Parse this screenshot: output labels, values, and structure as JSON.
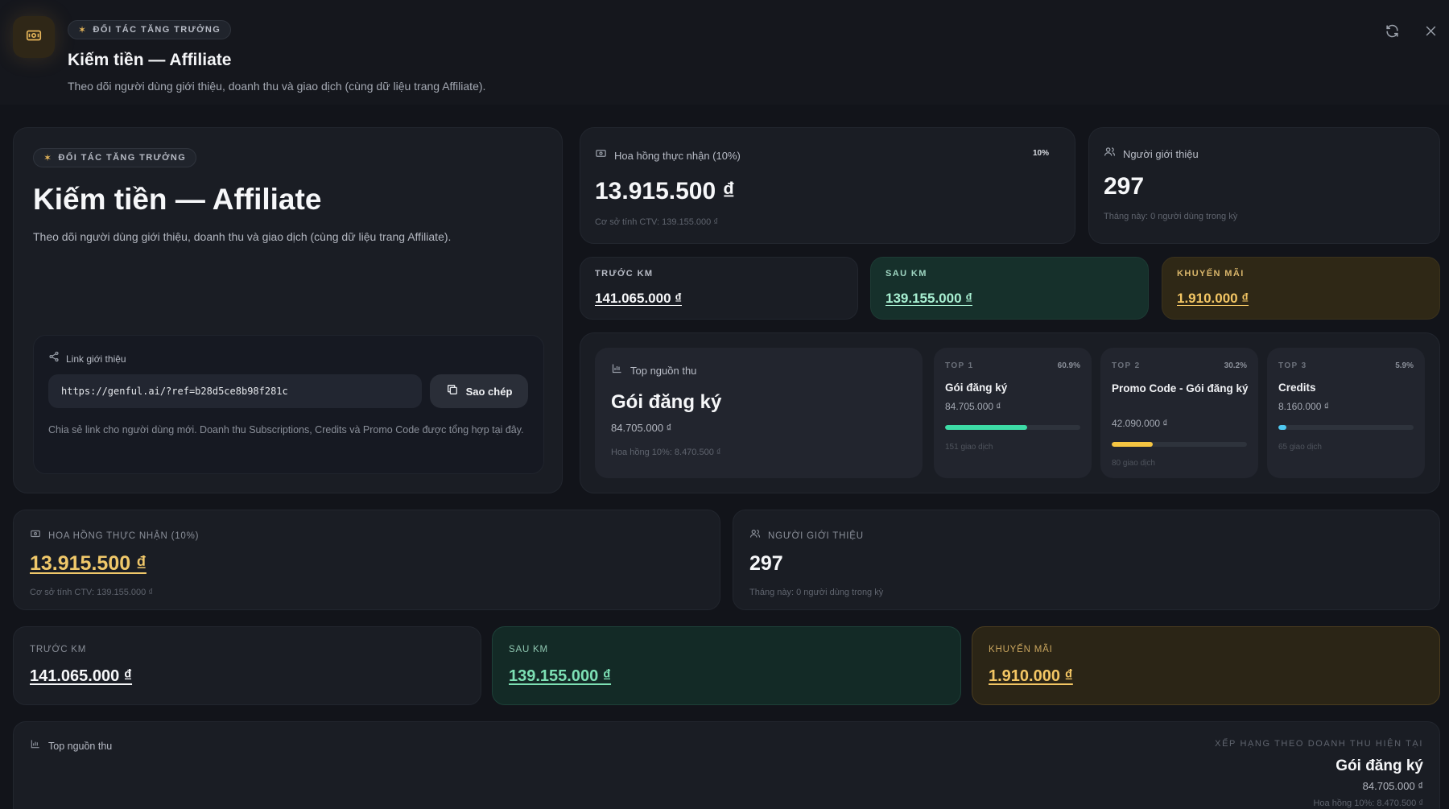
{
  "header": {
    "badge": "ĐỐI TÁC TĂNG TRƯỞNG",
    "title": "Kiếm tiền — Affiliate",
    "subtitle": "Theo dõi người dùng giới thiệu, doanh thu và giao dịch (cùng dữ liệu trang Affiliate)."
  },
  "hero": {
    "badge": "ĐỐI TÁC TĂNG TRƯỞNG",
    "title": "Kiếm tiền — Affiliate",
    "subtitle": "Theo dõi người dùng giới thiệu, doanh thu và giao dịch (cùng dữ liệu trang Affiliate).",
    "referral": {
      "label": "Link giới thiệu",
      "url": "https://genful.ai/?ref=b28d5ce8b98f281c",
      "copy_label": "Sao chép",
      "note": "Chia sẻ link cho người dùng mới. Doanh thu Subscriptions, Credits và Promo Code được tổng hợp tại đây."
    }
  },
  "commission": {
    "label": "Hoa hồng thực nhận (10%)",
    "rate_badge": "10%",
    "value": "13.915.500 ₫",
    "base": "Cơ sở tính CTV: 139.155.000 ₫"
  },
  "referrers": {
    "label": "Người giới thiệu",
    "value": "297",
    "note": "Tháng này: 0 người dùng trong kỳ"
  },
  "before": {
    "label": "TRƯỚC KM",
    "value": "141.065.000 ₫"
  },
  "after": {
    "label": "SAU KM",
    "value": "139.155.000 ₫"
  },
  "promo": {
    "label": "KHUYẾN MÃI",
    "value": "1.910.000 ₫"
  },
  "top_source": {
    "label": "Top nguồn thu",
    "name": "Gói đăng ký",
    "amount": "84.705.000 ₫",
    "commission": "Hoa hồng 10%: 8.470.500 ₫"
  },
  "tops": [
    {
      "rank": "TOP 1",
      "pct": "60.9%",
      "pct_value": 60.9,
      "name": "Gói đăng ký",
      "amount": "84.705.000 ₫",
      "txns": "151 giao dịch",
      "color": "#3ddba6"
    },
    {
      "rank": "TOP 2",
      "pct": "30.2%",
      "pct_value": 30.2,
      "name": "Promo Code - Gói đăng ký",
      "amount": "42.090.000 ₫",
      "txns": "80 giao dịch",
      "color": "#f5c542"
    },
    {
      "rank": "TOP 3",
      "pct": "5.9%",
      "pct_value": 5.9,
      "name": "Credits",
      "amount": "8.160.000 ₫",
      "txns": "65 giao dịch",
      "color": "#4fc8f0"
    }
  ],
  "lower": {
    "commission_label": "HOA HỒNG THỰC NHẬN (10%)",
    "referrers_label": "NGƯỜI GIỚI THIỆU",
    "before_label": "TRƯỚC KM",
    "after_label": "SAU KM",
    "promo_label": "KHUYẾN MÃI",
    "ranking_caption": "XẾP HẠNG THEO DOANH THU HIỆN TẠI"
  },
  "colors": {
    "gold": "#f0c86a",
    "mint": "#7de0b4",
    "teal_bg": "#15302a",
    "gold_bg": "#2e2717"
  }
}
